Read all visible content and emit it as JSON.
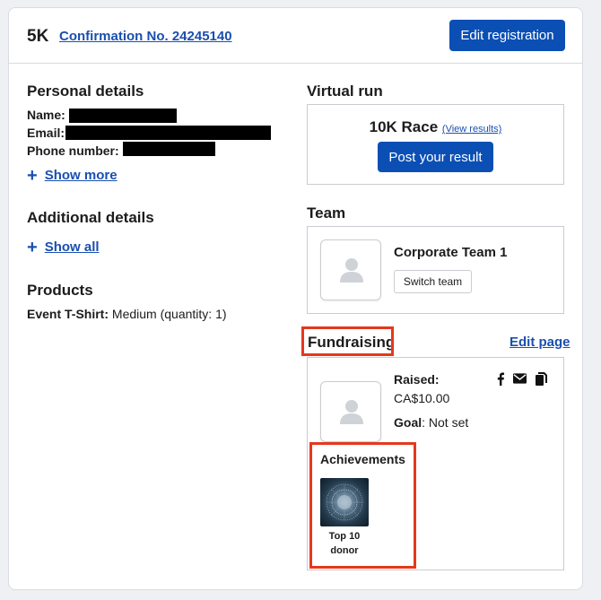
{
  "header": {
    "event_name": "5K",
    "confirmation": "Confirmation No. 24245140",
    "edit_registration": "Edit registration"
  },
  "personal": {
    "title": "Personal details",
    "name_label": "Name:",
    "email_label": "Email:",
    "phone_label": "Phone number:",
    "show_more": "Show more"
  },
  "additional": {
    "title": "Additional details",
    "show_all": "Show all"
  },
  "products": {
    "title": "Products",
    "item_label": "Event T-Shirt:",
    "item_value": " Medium (quantity: 1)"
  },
  "virtual_run": {
    "title": "Virtual run",
    "race_name": "10K Race",
    "view_results": "(View results)",
    "post_result": "Post your result"
  },
  "team": {
    "title": "Team",
    "team_name": "Corporate Team 1",
    "switch_team": "Switch team"
  },
  "fundraising": {
    "title": "Fundraising",
    "edit_page": "Edit page",
    "raised_label": "Raised:",
    "raised_value": "CA$10.00",
    "goal_label": "Goal",
    "goal_value": ": Not set",
    "social_icons": [
      "facebook-icon",
      "email-icon",
      "copy-icon"
    ],
    "achievements_title": "Achievements",
    "badge_line1": "Top 10",
    "badge_line2": "donor"
  },
  "colors": {
    "accent": "#0b4fb5",
    "link": "#1a4fb0",
    "highlight": "#e5381c"
  }
}
